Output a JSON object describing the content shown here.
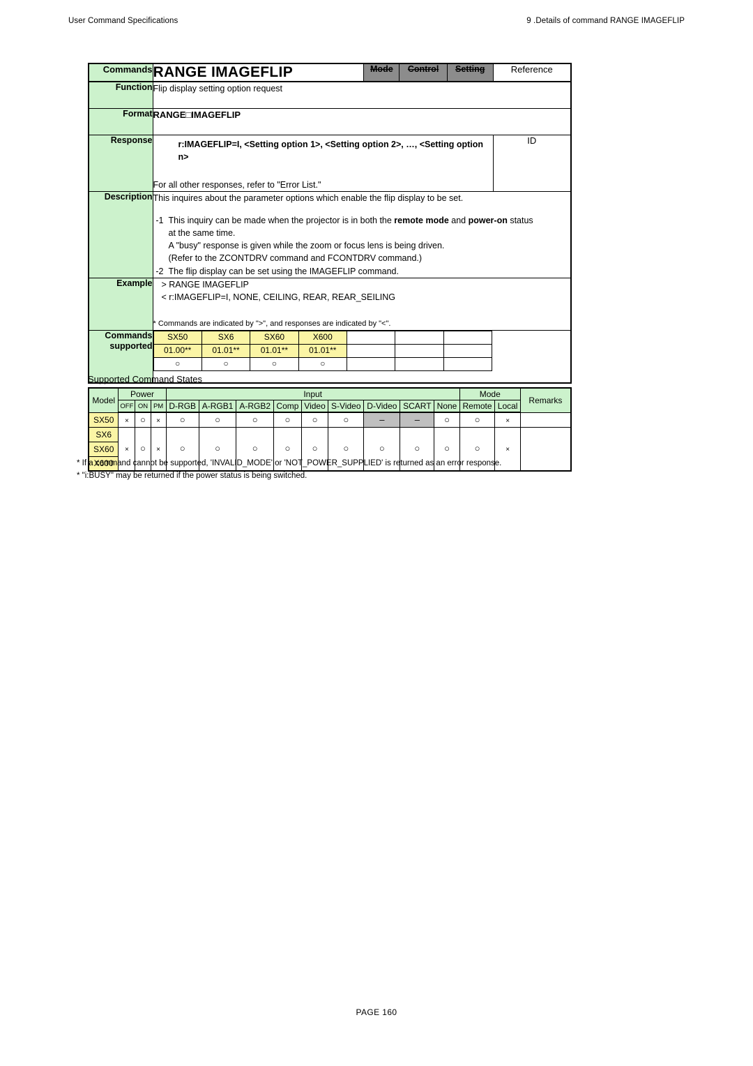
{
  "header": {
    "left": "User Command Specifications",
    "right": "9 .Details of command  RANGE IMAGEFLIP"
  },
  "command": {
    "label_commands": "Commands",
    "title": "RANGE IMAGEFLIP",
    "categories": [
      {
        "label": "Mode",
        "active": false
      },
      {
        "label": "Control",
        "active": false
      },
      {
        "label": "Setting",
        "active": false
      },
      {
        "label": "Reference",
        "active": true
      }
    ],
    "label_function": "Function",
    "function_text": "Flip display setting option request",
    "label_format": "Format",
    "format_text": "RANGE□IMAGEFLIP",
    "label_response": "Response",
    "response_main": "r:IMAGEFLIP=I, <Setting option 1>, <Setting option 2>, …, <Setting option n>",
    "response_sub": "For all other responses, refer to \"Error List.\"",
    "id_label": "ID",
    "label_description": "Description",
    "description_intro": "This inquires about the parameter options which enable the flip display to be set.",
    "description_items": [
      {
        "num": "-1",
        "lines": [
          "This inquiry can be made when the projector is in both the <b>remote mode</b> and <b>power-on</b> status",
          "at the same time.",
          "A \"busy\" response is given while the zoom or focus lens is being driven.",
          "(Refer to the ZCONTDRV command and FCONTDRV command.)"
        ]
      },
      {
        "num": "-2",
        "lines": [
          "The flip display can be set using the IMAGEFLIP command."
        ]
      }
    ],
    "label_example": "Example",
    "example_lines": [
      "> RANGE IMAGEFLIP",
      "< r:IMAGEFLIP=I, NONE, CEILING, REAR, REAR_SEILING"
    ],
    "example_note": "* Commands are indicated by \">\", and responses are indicated by \"<\".",
    "label_supported": "Commands\nsupported",
    "supported": {
      "models": [
        {
          "name": "SX50",
          "version": "01.00**",
          "mark": "○"
        },
        {
          "name": "SX6",
          "version": "01.01**",
          "mark": "○"
        },
        {
          "name": "SX60",
          "version": "01.01**",
          "mark": "○"
        },
        {
          "name": "X600",
          "version": "01.01**",
          "mark": "○"
        }
      ],
      "empty_columns": 3
    }
  },
  "states": {
    "title": "Supported Command States",
    "headers": {
      "model": "Model",
      "power": "Power",
      "power_sub": [
        "OFF",
        "ON",
        "PM"
      ],
      "input": "Input",
      "input_sub": [
        "D-RGB",
        "A-RGB1",
        "A-RGB2",
        "Comp",
        "Video",
        "S-Video",
        "D-Video",
        "SCART",
        "None"
      ],
      "mode": "Mode",
      "mode_sub": [
        "Remote",
        "Local"
      ],
      "remarks": "Remarks"
    },
    "rows": [
      {
        "models": [
          "SX50"
        ],
        "values": [
          "×",
          "○",
          "×",
          "○",
          "○",
          "○",
          "○",
          "○",
          "○",
          "–",
          "–",
          "○",
          "○",
          "×"
        ],
        "na_index": [
          9,
          10
        ],
        "remarks": ""
      },
      {
        "models": [
          "SX6",
          "SX60",
          "X600"
        ],
        "values": [
          "×",
          "○",
          "×",
          "○",
          "○",
          "○",
          "○",
          "○",
          "○",
          "○",
          "○",
          "○",
          "○",
          "×"
        ],
        "na_index": [],
        "remarks": ""
      }
    ]
  },
  "footnotes": [
    "* If a command cannot be supported, 'INVALID_MODE' or 'NOT_POWER_SUPPLIED' is returned as an error response.",
    "* \"i:BUSY\" may be returned if the power status is being switched."
  ],
  "footer": {
    "page": "PAGE 160"
  }
}
